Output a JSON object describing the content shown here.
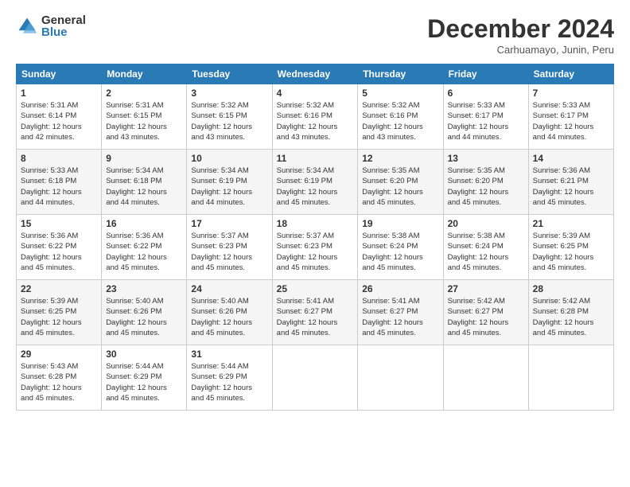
{
  "logo": {
    "general": "General",
    "blue": "Blue"
  },
  "title": "December 2024",
  "subtitle": "Carhuamayo, Junin, Peru",
  "weekdays": [
    "Sunday",
    "Monday",
    "Tuesday",
    "Wednesday",
    "Thursday",
    "Friday",
    "Saturday"
  ],
  "weeks": [
    [
      {
        "day": 1,
        "sunrise": "5:31 AM",
        "sunset": "6:14 PM",
        "daylight": "12 hours and 42 minutes."
      },
      {
        "day": 2,
        "sunrise": "5:31 AM",
        "sunset": "6:15 PM",
        "daylight": "12 hours and 43 minutes."
      },
      {
        "day": 3,
        "sunrise": "5:32 AM",
        "sunset": "6:15 PM",
        "daylight": "12 hours and 43 minutes."
      },
      {
        "day": 4,
        "sunrise": "5:32 AM",
        "sunset": "6:16 PM",
        "daylight": "12 hours and 43 minutes."
      },
      {
        "day": 5,
        "sunrise": "5:32 AM",
        "sunset": "6:16 PM",
        "daylight": "12 hours and 43 minutes."
      },
      {
        "day": 6,
        "sunrise": "5:33 AM",
        "sunset": "6:17 PM",
        "daylight": "12 hours and 44 minutes."
      },
      {
        "day": 7,
        "sunrise": "5:33 AM",
        "sunset": "6:17 PM",
        "daylight": "12 hours and 44 minutes."
      }
    ],
    [
      {
        "day": 8,
        "sunrise": "5:33 AM",
        "sunset": "6:18 PM",
        "daylight": "12 hours and 44 minutes."
      },
      {
        "day": 9,
        "sunrise": "5:34 AM",
        "sunset": "6:18 PM",
        "daylight": "12 hours and 44 minutes."
      },
      {
        "day": 10,
        "sunrise": "5:34 AM",
        "sunset": "6:19 PM",
        "daylight": "12 hours and 44 minutes."
      },
      {
        "day": 11,
        "sunrise": "5:34 AM",
        "sunset": "6:19 PM",
        "daylight": "12 hours and 45 minutes."
      },
      {
        "day": 12,
        "sunrise": "5:35 AM",
        "sunset": "6:20 PM",
        "daylight": "12 hours and 45 minutes."
      },
      {
        "day": 13,
        "sunrise": "5:35 AM",
        "sunset": "6:20 PM",
        "daylight": "12 hours and 45 minutes."
      },
      {
        "day": 14,
        "sunrise": "5:36 AM",
        "sunset": "6:21 PM",
        "daylight": "12 hours and 45 minutes."
      }
    ],
    [
      {
        "day": 15,
        "sunrise": "5:36 AM",
        "sunset": "6:22 PM",
        "daylight": "12 hours and 45 minutes."
      },
      {
        "day": 16,
        "sunrise": "5:36 AM",
        "sunset": "6:22 PM",
        "daylight": "12 hours and 45 minutes."
      },
      {
        "day": 17,
        "sunrise": "5:37 AM",
        "sunset": "6:23 PM",
        "daylight": "12 hours and 45 minutes."
      },
      {
        "day": 18,
        "sunrise": "5:37 AM",
        "sunset": "6:23 PM",
        "daylight": "12 hours and 45 minutes."
      },
      {
        "day": 19,
        "sunrise": "5:38 AM",
        "sunset": "6:24 PM",
        "daylight": "12 hours and 45 minutes."
      },
      {
        "day": 20,
        "sunrise": "5:38 AM",
        "sunset": "6:24 PM",
        "daylight": "12 hours and 45 minutes."
      },
      {
        "day": 21,
        "sunrise": "5:39 AM",
        "sunset": "6:25 PM",
        "daylight": "12 hours and 45 minutes."
      }
    ],
    [
      {
        "day": 22,
        "sunrise": "5:39 AM",
        "sunset": "6:25 PM",
        "daylight": "12 hours and 45 minutes."
      },
      {
        "day": 23,
        "sunrise": "5:40 AM",
        "sunset": "6:26 PM",
        "daylight": "12 hours and 45 minutes."
      },
      {
        "day": 24,
        "sunrise": "5:40 AM",
        "sunset": "6:26 PM",
        "daylight": "12 hours and 45 minutes."
      },
      {
        "day": 25,
        "sunrise": "5:41 AM",
        "sunset": "6:27 PM",
        "daylight": "12 hours and 45 minutes."
      },
      {
        "day": 26,
        "sunrise": "5:41 AM",
        "sunset": "6:27 PM",
        "daylight": "12 hours and 45 minutes."
      },
      {
        "day": 27,
        "sunrise": "5:42 AM",
        "sunset": "6:27 PM",
        "daylight": "12 hours and 45 minutes."
      },
      {
        "day": 28,
        "sunrise": "5:42 AM",
        "sunset": "6:28 PM",
        "daylight": "12 hours and 45 minutes."
      }
    ],
    [
      {
        "day": 29,
        "sunrise": "5:43 AM",
        "sunset": "6:28 PM",
        "daylight": "12 hours and 45 minutes."
      },
      {
        "day": 30,
        "sunrise": "5:44 AM",
        "sunset": "6:29 PM",
        "daylight": "12 hours and 45 minutes."
      },
      {
        "day": 31,
        "sunrise": "5:44 AM",
        "sunset": "6:29 PM",
        "daylight": "12 hours and 45 minutes."
      },
      null,
      null,
      null,
      null
    ]
  ]
}
